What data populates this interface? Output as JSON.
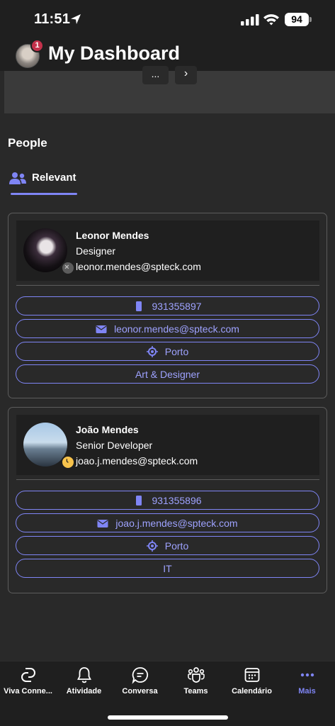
{
  "status_bar": {
    "time": "11:51",
    "battery": "94"
  },
  "header": {
    "title": "My Dashboard",
    "notification_count": "1"
  },
  "strip": {
    "more_label": "...",
    "next_label": "›"
  },
  "people": {
    "section_title": "People",
    "tab_label": "Relevant",
    "cards": [
      {
        "name": "Leonor Mendes",
        "role": "Designer",
        "email": "leonor.mendes@spteck.com",
        "phone": "931355897",
        "contact_email": "leonor.mendes@spteck.com",
        "location": "Porto",
        "department": "Art & Designer",
        "presence": "offline"
      },
      {
        "name": "João Mendes",
        "role": "Senior Developer",
        "email": "joao.j.mendes@spteck.com",
        "phone": "931355896",
        "contact_email": "joao.j.mendes@spteck.com",
        "location": "Porto",
        "department": "IT",
        "presence": "away"
      }
    ]
  },
  "bottom_nav": {
    "items": [
      {
        "label": "Viva Conne...",
        "icon": "viva-connections-icon"
      },
      {
        "label": "Atividade",
        "icon": "bell-icon"
      },
      {
        "label": "Conversa",
        "icon": "chat-icon"
      },
      {
        "label": "Teams",
        "icon": "teams-icon"
      },
      {
        "label": "Calendário",
        "icon": "calendar-icon"
      },
      {
        "label": "Mais",
        "icon": "more-icon",
        "active": true
      }
    ]
  },
  "colors": {
    "accent": "#7f85f5",
    "background": "#292929",
    "surface": "#1f1f1f",
    "badge": "#c4314b"
  }
}
